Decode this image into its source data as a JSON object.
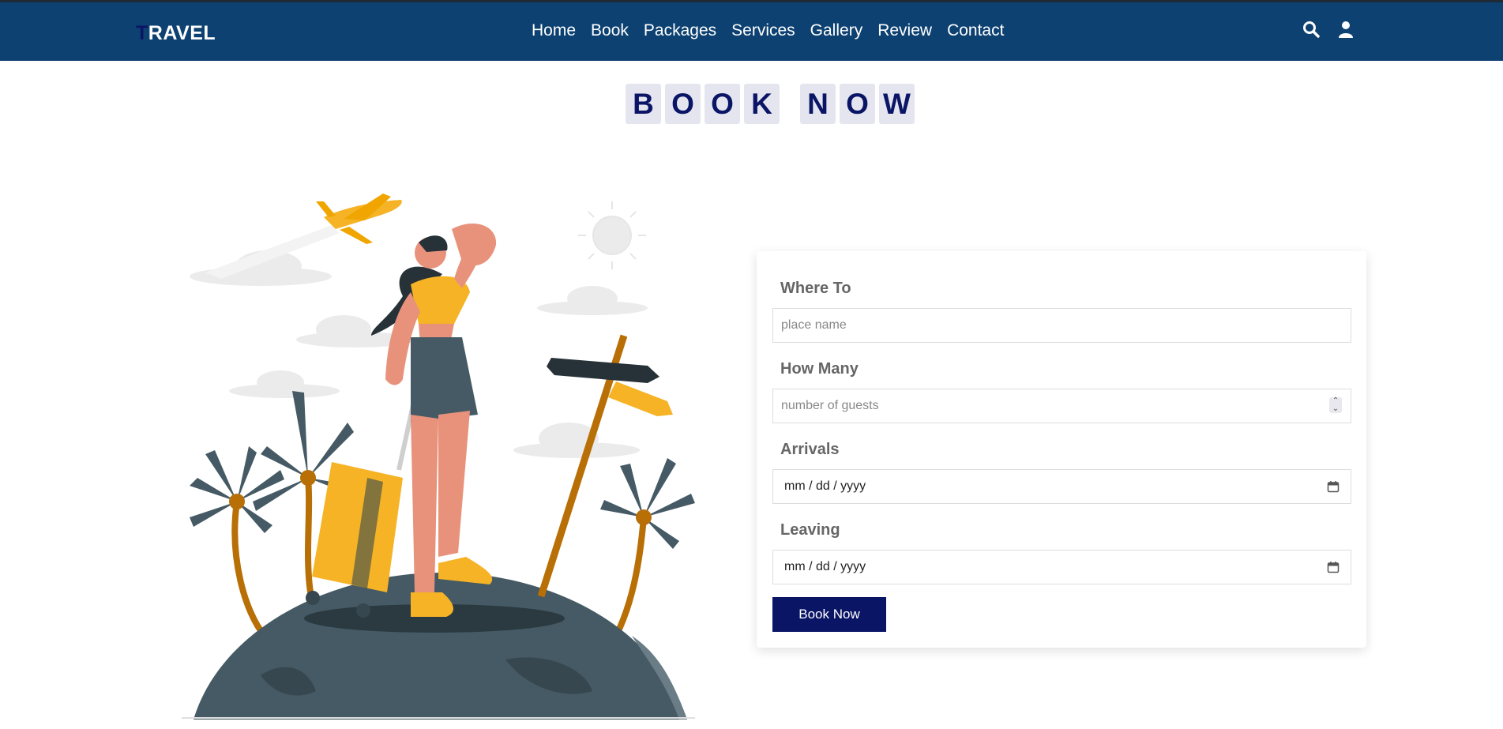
{
  "header": {
    "logo_first": "T",
    "logo_rest": "RAVEL",
    "nav": [
      "Home",
      "Book",
      "Packages",
      "Services",
      "Gallery",
      "Review",
      "Contact"
    ],
    "icons": [
      "search-icon",
      "user-icon"
    ],
    "bg_color": "#0c4171"
  },
  "heading": {
    "letters": [
      "B",
      "O",
      "O",
      "K",
      "",
      "N",
      "O",
      "W"
    ]
  },
  "form": {
    "where_label": "Where To",
    "where_placeholder": "place name",
    "how_many_label": "How Many",
    "how_many_placeholder": "number of guests",
    "arrivals_label": "Arrivals",
    "arrivals_value": "mm / dd / yyyy",
    "leaving_label": "Leaving",
    "leaving_value": "mm / dd / yyyy",
    "submit_label": "Book Now",
    "accent_color": "#0b1566"
  }
}
